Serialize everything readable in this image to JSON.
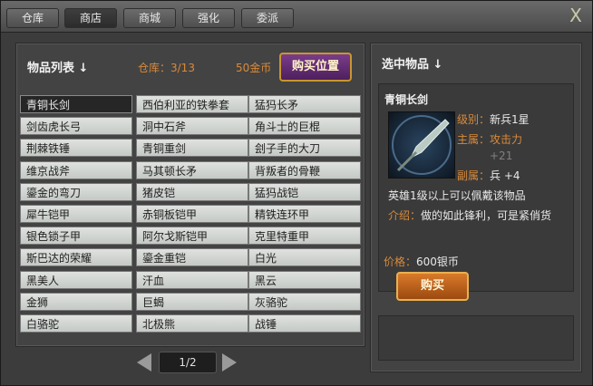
{
  "tabs": [
    {
      "label": "仓库",
      "active": false
    },
    {
      "label": "商店",
      "active": true
    },
    {
      "label": "商城",
      "active": false
    },
    {
      "label": "强化",
      "active": false
    },
    {
      "label": "委派",
      "active": false
    }
  ],
  "close_icon": "X",
  "list_panel": {
    "title": "物品列表",
    "title_arrow": "↓",
    "warehouse_label": "仓库：3/13",
    "gold": "50金币",
    "buy_position_label": "购买位置"
  },
  "items": [
    [
      "青铜长剑",
      "西伯利亚的铁拳套",
      "猛犸长矛"
    ],
    [
      "剑齿虎长弓",
      "洞中石斧",
      "角斗士的巨棍"
    ],
    [
      "荆棘铁锤",
      "青铜重剑",
      "刽子手的大刀"
    ],
    [
      "维京战斧",
      "马其顿长矛",
      "背叛者的骨鞭"
    ],
    [
      "鎏金的弯刀",
      "猪皮铠",
      "猛犸战铠"
    ],
    [
      "犀牛铠甲",
      "赤铜板铠甲",
      "精铁连环甲"
    ],
    [
      "银色锁子甲",
      "阿尔戈斯铠甲",
      "克里特重甲"
    ],
    [
      "斯巴达的荣耀",
      "鎏金重铠",
      "白光"
    ],
    [
      "黑美人",
      "汗血",
      "黑云"
    ],
    [
      "金狮",
      "巨蝎",
      "灰骆驼"
    ],
    [
      "白骆驼",
      "北极熊",
      "战锤"
    ]
  ],
  "pager": {
    "label": "1/2"
  },
  "detail_panel": {
    "title": "选中物品",
    "title_arrow": "↓",
    "item_name": "青铜长剑",
    "level_label": "级别：",
    "level_value": "新兵1星",
    "main_attr_label": "主属：",
    "main_attr_value": "攻击力",
    "main_attr_bonus": "+21",
    "sub_attr_label": "副属：",
    "sub_attr_value": "兵 +4",
    "requirement": "英雄1级以上可以佩戴该物品",
    "intro_label": "介绍：",
    "intro_text": "做的如此锋利，可是紧俏货",
    "price_label": "价格：",
    "price_value": "600银币",
    "buy_label": "购买"
  }
}
